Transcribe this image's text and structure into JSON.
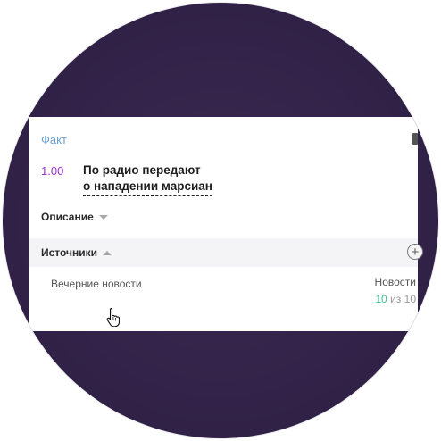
{
  "fact": {
    "label": "Факт",
    "score": "1.00",
    "title_line1": "По радио передают",
    "title_line2": "о нападении марсиан"
  },
  "sections": {
    "description_label": "Описание",
    "sources_label": "Источники"
  },
  "source": {
    "name": "Вечерние новости",
    "type": "Новости",
    "score_value": "10",
    "score_sep": "из",
    "score_max": "10"
  },
  "icons": {
    "description_toggle": "triangle-down-icon",
    "sources_toggle": "triangle-up-icon",
    "add": "plus-circle-icon",
    "cursor": "hand-pointer-icon"
  },
  "colors": {
    "background": "#33234a",
    "fact_label": "#6aa0d8",
    "score": "#9b2fd1",
    "source_score_value": "#3cc48a"
  }
}
